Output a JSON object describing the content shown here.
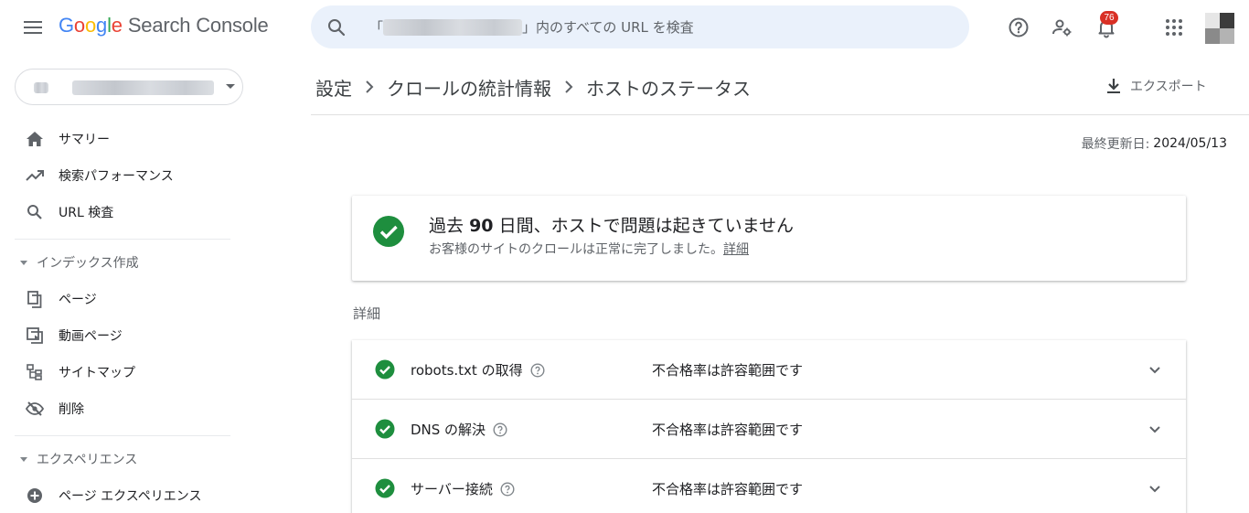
{
  "header": {
    "logo": {
      "g1": "G",
      "g2": "o",
      "g3": "o",
      "g4": "g",
      "g5": "l",
      "g6": "e",
      "product": "Search Console"
    },
    "search": {
      "prefix": "「",
      "suffix": "」内のすべての URL を検査"
    },
    "notifications_count": "76"
  },
  "breadcrumb": [
    "設定",
    "クロールの統計情報",
    "ホストのステータス"
  ],
  "export_label": "エクスポート",
  "last_updated": {
    "label": "最終更新日:",
    "value": "2024/05/13"
  },
  "status_card": {
    "headline_prefix": "過去",
    "headline_days": "90",
    "headline_suffix": "日間、ホストで問題は起きていません",
    "subtitle": "お客様のサイトのクロールは正常に完了しました。",
    "link": "詳細"
  },
  "details_title": "詳細",
  "details": [
    {
      "name": "robots.txt の取得",
      "status": "不合格率は許容範囲です"
    },
    {
      "name": "DNS の解決",
      "status": "不合格率は許容範囲です"
    },
    {
      "name": "サーバー接続",
      "status": "不合格率は許容範囲です"
    }
  ],
  "sidebar": {
    "items_top": [
      {
        "label": "サマリー",
        "icon": "home-icon"
      },
      {
        "label": "検索パフォーマンス",
        "icon": "trending-icon"
      },
      {
        "label": "URL 検査",
        "icon": "search-icon"
      }
    ],
    "section_index": "インデックス作成",
    "items_index": [
      {
        "label": "ページ",
        "icon": "pages-icon"
      },
      {
        "label": "動画ページ",
        "icon": "video-icon"
      },
      {
        "label": "サイトマップ",
        "icon": "sitemap-icon"
      },
      {
        "label": "削除",
        "icon": "removal-icon"
      }
    ],
    "section_experience": "エクスペリエンス",
    "items_experience": [
      {
        "label": "ページ エクスペリエンス",
        "icon": "plus-circle-icon"
      }
    ]
  },
  "colors": {
    "success": "#1e8e3e",
    "accent": "#1a73e8",
    "badge": "#d93025"
  }
}
